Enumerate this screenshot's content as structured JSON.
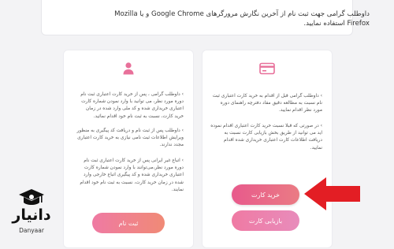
{
  "header": {
    "notice": "داوطلب گرامی جهت ثبت نام از آخرین نگارش مرورگرهای Google Chrome و یا Mozilla Firefox استفاده نمایید."
  },
  "left_card": {
    "icon": "user-icon",
    "para1": "› داوطلب گرامی ، پس از خرید کارت اعتباری ثبت نام دوره مورد نظر، می توانید با وارد نمودن شماره کارت اعتباری خریداری شده و کد ملی وارد شده در زمان خرید کارت، نسبت به ثبت نام خود اقدام نمائید.",
    "para2": "› داوطلب پس از ثبت نام و دریافت کد پیگیری به منظور ویرایش اطلاعات ثبت نامی نیازی به خرید کارت اعتباری مجدد ندارند.",
    "para3": "› اتباع غیر ایرانی پس از خرید کارت اعتباری ثبت نام دوره مورد نظر،می‌توانند با وارد نمودن شماره کارت اعتباری خریداری شده و کد پیگیری اتباع خارجی وارد شده در زمان خرید کارت، نسبت به ثبت نام خود اقدام نمایند.",
    "register_label": "ثبت نام"
  },
  "right_card": {
    "icon": "credit-card-icon",
    "para1": "› داوطلب گرامی قبل از اقدام به خرید کارت اعتباری ثبت نام نسبت به مطالعه دقیق مفاد دفترچه راهنمای دوره مورد نظر اقدام نمایید.",
    "para2": "› در صورتی که قبلا نسبت خرید کارت اعتباری اقدام نموده اید می توانید از طریق بخش بازیابی کارت نسبت به دریافت اطلاعات کارت اعتباری خریداری شده اقدام نمایید.",
    "buy_label": "خرید کارت",
    "recover_label": "بازیابی کارت"
  },
  "logo": {
    "name": "دانیار",
    "sub": "Danyaar"
  },
  "colors": {
    "button_primary": "#e85a8c",
    "button_secondary": "#ef7aa3",
    "arrow": "#e31e24",
    "icon": "#e8709a"
  }
}
